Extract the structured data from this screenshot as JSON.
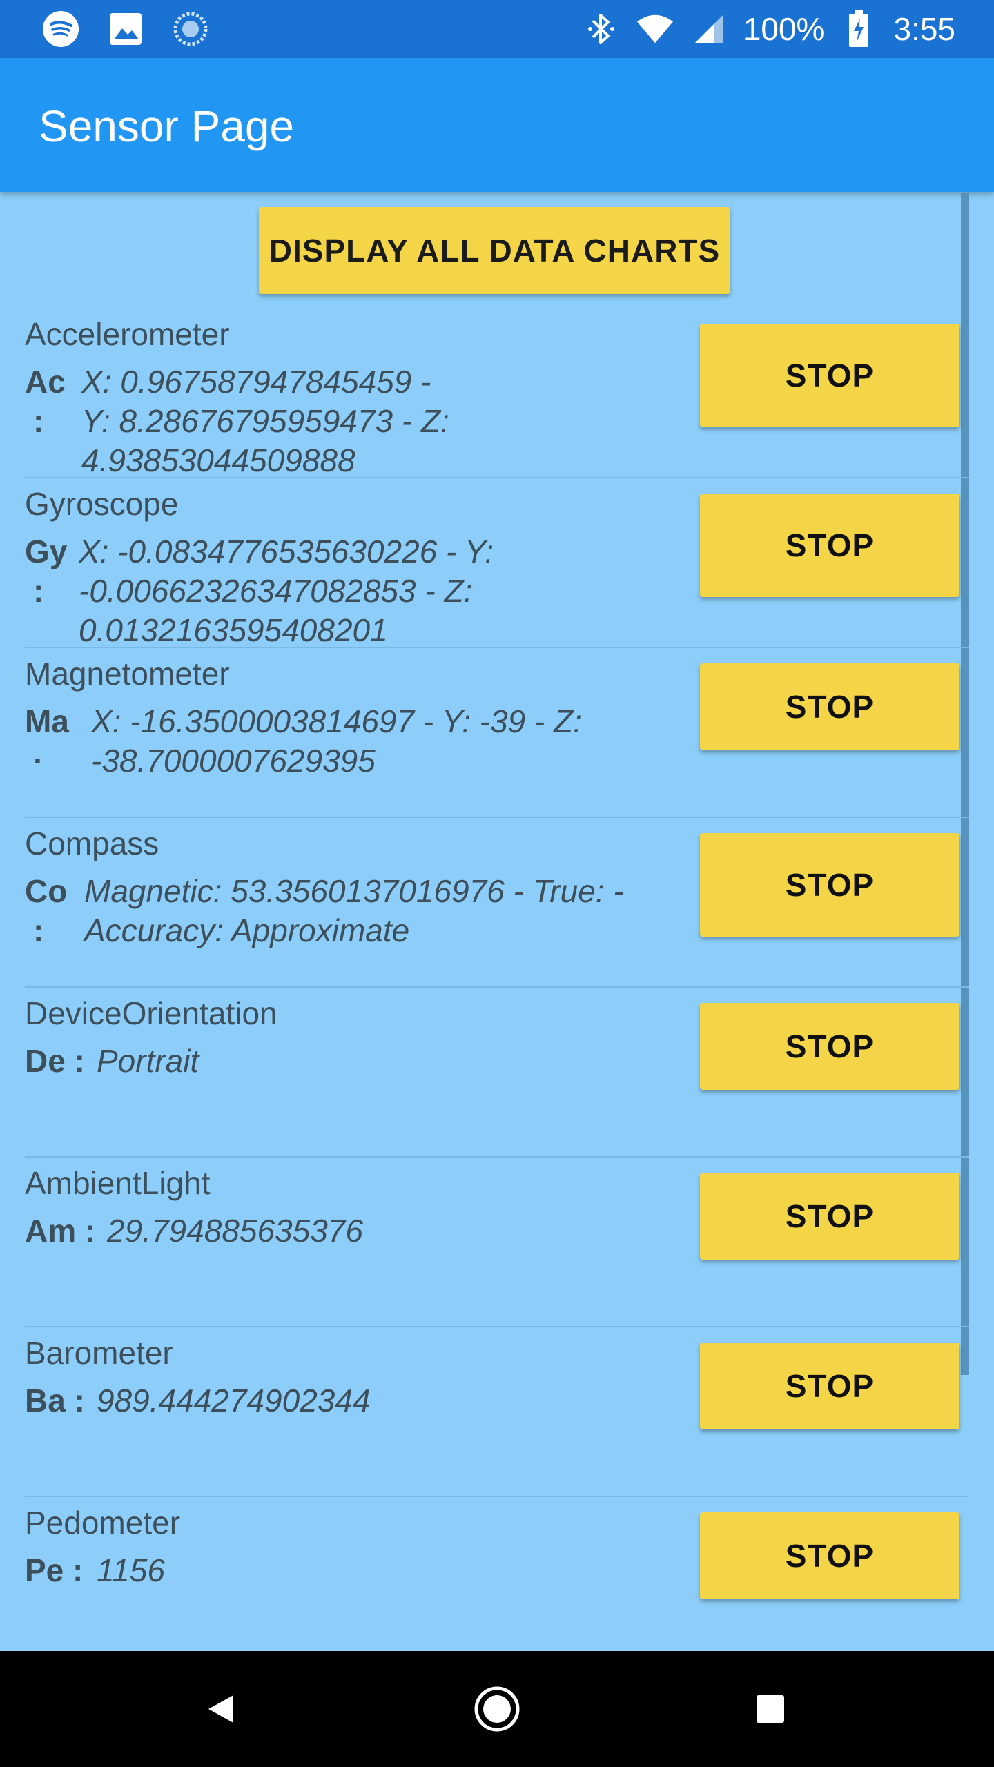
{
  "status_bar": {
    "battery": "100%",
    "time": "3:55",
    "icons": [
      "spotify-icon",
      "image-icon",
      "sync-icon",
      "bluetooth-icon",
      "wifi-icon",
      "signal-icon",
      "battery-charging-icon"
    ]
  },
  "app_bar": {
    "title": "Sensor Page"
  },
  "display_all_button": "DISPLAY ALL DATA CHARTS",
  "sensors": [
    {
      "name": "Accelerometer",
      "abbr": "Ac",
      "abbr_colon": ":",
      "value_lines": [
        "X: 0.967587947845459 -",
        "Y: 8.28676795959473 - Z:",
        "4.93853044509888"
      ],
      "button": "STOP"
    },
    {
      "name": "Gyroscope",
      "abbr": "Gy",
      "abbr_colon": ":",
      "value_lines": [
        "X: -0.0834776535630226 - Y:",
        "-0.00662326347082853 - Z:",
        "0.0132163595408201"
      ],
      "button": "STOP"
    },
    {
      "name": "Magnetometer",
      "abbr": "Ma",
      "abbr_colon": "·",
      "value_lines": [
        "X: -16.3500003814697 - Y: -39 - Z:",
        "-38.7000007629395"
      ],
      "button": "STOP"
    },
    {
      "name": "Compass",
      "abbr": "Co",
      "abbr_colon": ":",
      "value_lines": [
        "Magnetic: 53.3560137016976 - True:  -",
        "Accuracy: Approximate"
      ],
      "button": "STOP"
    },
    {
      "name": "DeviceOrientation",
      "abbr": "De :",
      "value_lines": [
        "Portrait"
      ],
      "button": "STOP"
    },
    {
      "name": "AmbientLight",
      "abbr": "Am :",
      "value_lines": [
        "29.794885635376"
      ],
      "button": "STOP"
    },
    {
      "name": "Barometer",
      "abbr": "Ba :",
      "value_lines": [
        "989.444274902344"
      ],
      "button": "STOP"
    },
    {
      "name": "Pedometer",
      "abbr": "Pe :",
      "value_lines": [
        "1156"
      ],
      "button": "STOP"
    }
  ],
  "nav_bar": {
    "icons": [
      "back-icon",
      "home-icon",
      "recent-apps-icon"
    ]
  }
}
